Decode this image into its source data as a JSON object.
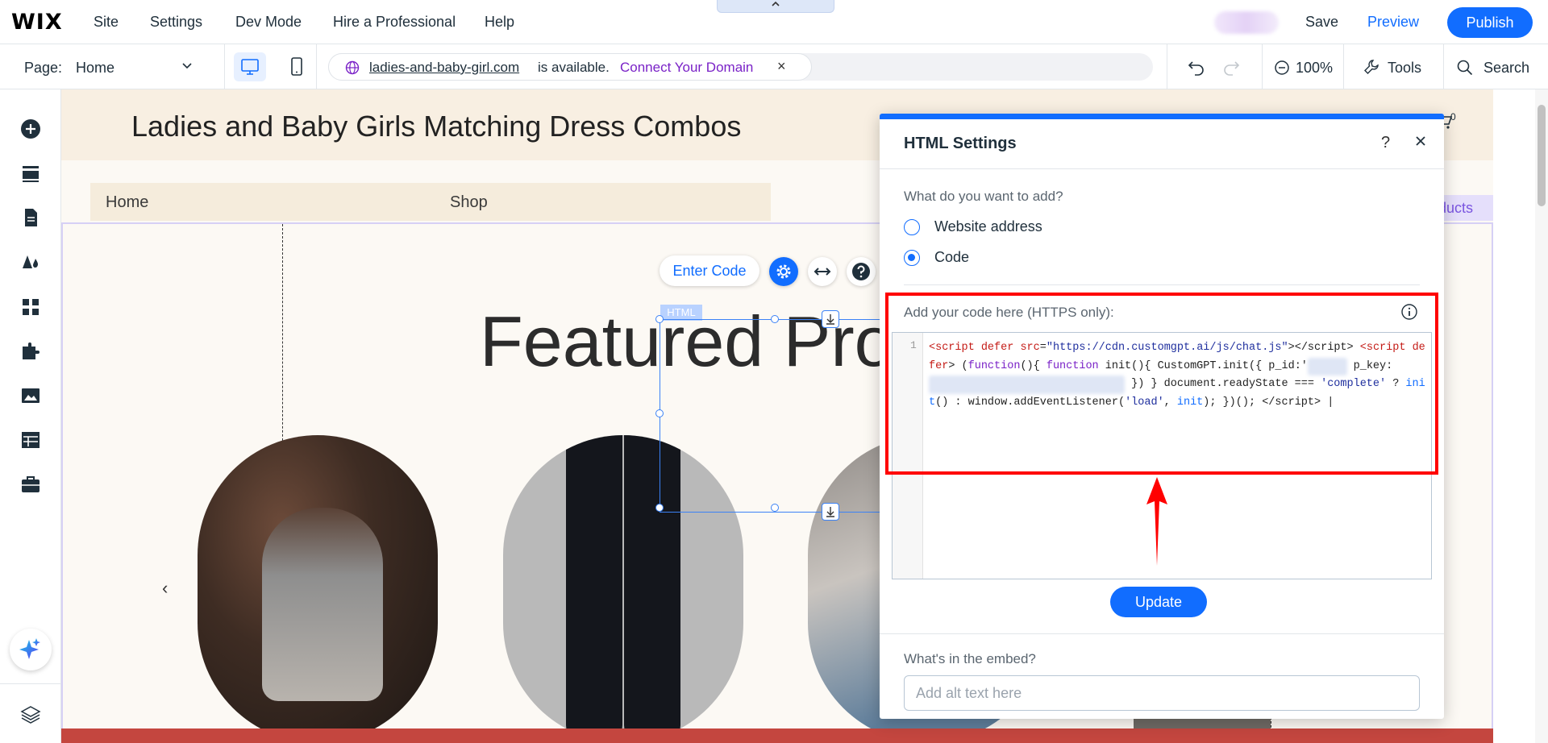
{
  "topbar": {
    "logo": "WIX",
    "menu": [
      "Site",
      "Settings",
      "Dev Mode",
      "Hire a Professional",
      "Help"
    ],
    "save_label": "Save",
    "preview_label": "Preview",
    "publish_label": "Publish",
    "accent_color": "#116dff"
  },
  "secondbar": {
    "page_label": "Page:",
    "page_value": "Home",
    "domain_name": "ladies-and-baby-girl.com",
    "domain_status": "is available.",
    "connect_label": "Connect Your Domain",
    "zoom": "100%",
    "tools_label": "Tools",
    "search_label": "Search"
  },
  "site": {
    "title": "Ladies and Baby Girls Matching Dress Combos",
    "nav": [
      "Home",
      "Shop"
    ],
    "heading": "Featured Pro",
    "products_tag": "ducts",
    "cart_count": "0",
    "carousel_prev": "‹"
  },
  "element_toolbar": {
    "enter_code_label": "Enter Code",
    "html_tag": "HTML"
  },
  "panel": {
    "title": "HTML Settings",
    "question": "What do you want to add?",
    "options": [
      {
        "label": "Website address",
        "selected": false
      },
      {
        "label": "Code",
        "selected": true
      }
    ],
    "code_label": "Add your code here (HTTPS only):",
    "line_number": "1",
    "update_label": "Update",
    "embed_label": "What's in the embed?",
    "alt_placeholder": "Add alt text here"
  },
  "annotation": {
    "highlight_color": "#ff0000"
  }
}
